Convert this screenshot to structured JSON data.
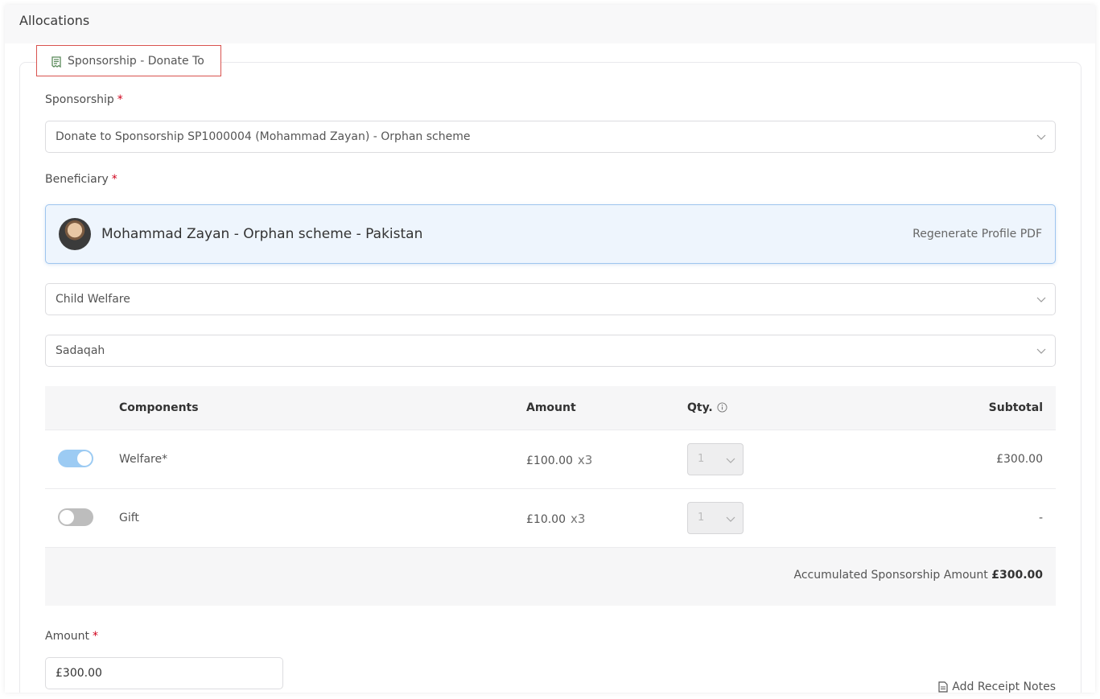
{
  "section": {
    "title": "Allocations"
  },
  "legend": {
    "label": "Sponsorship - Donate To",
    "icon": "receipt-icon"
  },
  "sponsorship": {
    "label": "Sponsorship",
    "required_mark": "*",
    "selected": "Donate to Sponsorship SP1000004 (Mohammad Zayan) - Orphan scheme"
  },
  "beneficiary": {
    "label": "Beneficiary",
    "required_mark": "*",
    "name": "Mohammad Zayan - Orphan scheme - Pakistan",
    "action": "Regenerate Profile PDF"
  },
  "category": {
    "selected": "Child Welfare"
  },
  "donation_type": {
    "selected": "Sadaqah"
  },
  "components_table": {
    "headers": {
      "components": "Components",
      "amount": "Amount",
      "qty": "Qty.",
      "subtotal": "Subtotal"
    },
    "rows": [
      {
        "enabled": true,
        "name": "Welfare*",
        "amount": "£100.00",
        "multiplier": "x3",
        "qty": "1",
        "subtotal": "£300.00"
      },
      {
        "enabled": false,
        "name": "Gift",
        "amount": "£10.00",
        "multiplier": "x3",
        "qty": "1",
        "subtotal": "-"
      }
    ],
    "accumulated_label": "Accumulated Sponsorship Amount",
    "accumulated_value": "£300.00"
  },
  "amount": {
    "label": "Amount",
    "required_mark": "*",
    "value": "£300.00"
  },
  "receipt_notes": {
    "label": "Add Receipt Notes"
  },
  "colors": {
    "accent": "#9ccbf3",
    "required": "#d0021b",
    "highlight_border": "#d9534f"
  }
}
